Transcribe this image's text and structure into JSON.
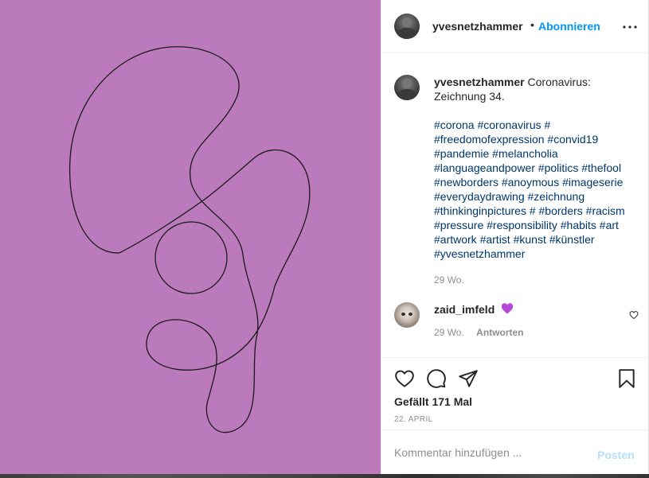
{
  "post": {
    "image_background": "#bb7abb",
    "image_description_icon": "line-drawing-artwork"
  },
  "header": {
    "username": "yvesnetzhammer",
    "separator": "•",
    "follow_label": "Abonnieren",
    "more_icon": "more-horizontal-icon"
  },
  "caption": {
    "username": "yvesnetzhammer",
    "text": "Coronavirus: Zeichnung 34.",
    "hashtags": "#corona #coronavirus # #freedomofexpression #convid19 #pandemie #melancholia #languageandpower #politics #thefool #newborders #anoymous #imageserie #everydaydrawing #zeichnung #thinkinginpictures # #borders #racism #pressure #responsibility #habits #art #artwork #artist #kunst #künstler #yvesnetzhammer",
    "time": "29 Wo."
  },
  "comments": [
    {
      "username": "zaid_imfeld",
      "emoji": "purple-heart",
      "time": "29 Wo.",
      "reply_label": "Antworten"
    }
  ],
  "actions": {
    "like_icon": "heart-icon",
    "comment_icon": "comment-icon",
    "share_icon": "share-icon",
    "save_icon": "bookmark-icon",
    "likes_text": "Gefällt 171 Mal",
    "date": "22. APRIL"
  },
  "add_comment": {
    "placeholder": "Kommentar hinzufügen ...",
    "post_label": "Posten"
  },
  "colors": {
    "accent": "#0095f6",
    "hashtag": "#00376b",
    "muted": "#8e8e8e",
    "post_disabled": "#b2dffc",
    "emoji_purple": "#b34bd6"
  }
}
